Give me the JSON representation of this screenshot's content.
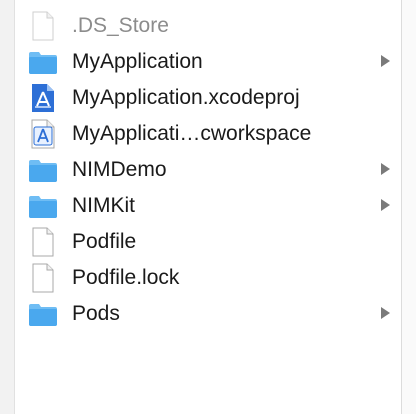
{
  "files": [
    {
      "name": ".DS_Store",
      "icon": "document-icon",
      "kind": "file",
      "hidden": true,
      "expandable": false
    },
    {
      "name": "MyApplication",
      "icon": "folder-icon",
      "kind": "folder",
      "hidden": false,
      "expandable": true
    },
    {
      "name": "MyApplication.xcodeproj",
      "icon": "xcode-project-icon",
      "kind": "xcodeproj",
      "hidden": false,
      "expandable": false
    },
    {
      "name": "MyApplicati…cworkspace",
      "icon": "xcode-workspace-icon",
      "kind": "xcworkspace",
      "hidden": false,
      "expandable": false
    },
    {
      "name": "NIMDemo",
      "icon": "folder-icon",
      "kind": "folder",
      "hidden": false,
      "expandable": true
    },
    {
      "name": "NIMKit",
      "icon": "folder-icon",
      "kind": "folder",
      "hidden": false,
      "expandable": true
    },
    {
      "name": "Podfile",
      "icon": "document-icon",
      "kind": "file",
      "hidden": false,
      "expandable": false
    },
    {
      "name": "Podfile.lock",
      "icon": "document-icon",
      "kind": "file",
      "hidden": false,
      "expandable": false
    },
    {
      "name": "Pods",
      "icon": "folder-icon",
      "kind": "folder",
      "hidden": false,
      "expandable": true
    }
  ],
  "colors": {
    "folder": "#4aa8ee",
    "folder_tab": "#6fbdf4",
    "xcode_blue": "#2d6fd6",
    "text": "#1a1a1a",
    "hidden_text": "#8c8c8c",
    "chevron": "#7a7a7a"
  }
}
